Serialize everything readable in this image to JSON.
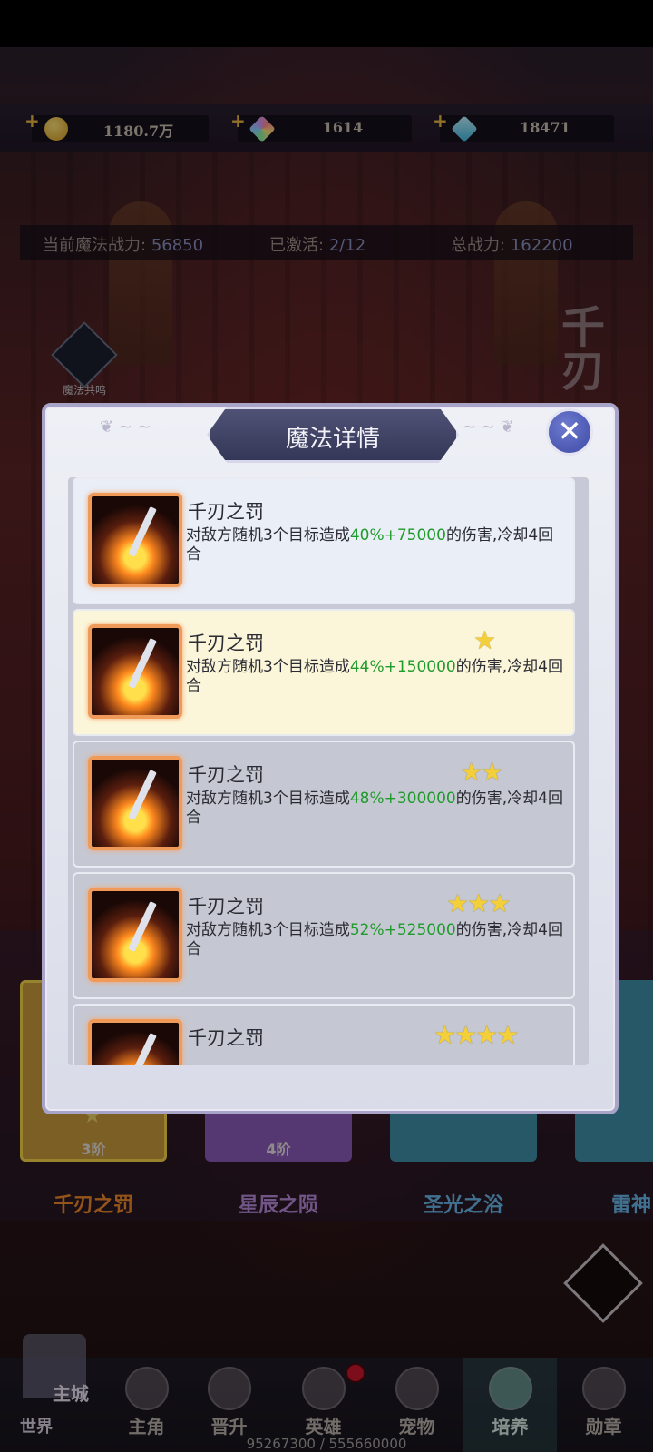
{
  "currency": [
    {
      "value": "1180.7万",
      "icon": "gold-coin-icon",
      "color": "#e8b23a"
    },
    {
      "value": "1614",
      "icon": "rainbow-gem-icon",
      "color": "#8bd1d8"
    },
    {
      "value": "18471",
      "icon": "blue-diamond-icon",
      "color": "#5ec9e8"
    }
  ],
  "stats": {
    "magic_power_label": "当前魔法战力:",
    "magic_power_value": "56850",
    "activated_label": "已激活:",
    "activated_value": "2/12",
    "total_power_label": "总战力:",
    "total_power_value": "162200"
  },
  "side": {
    "resonance_label": "魔法共鸣",
    "big_title_fragment": "千刃"
  },
  "modal": {
    "title": "魔法详情",
    "skills": [
      {
        "name": "千刃之罚",
        "stars": "",
        "desc_prefix": "对敌方随机3个目标造成",
        "highlight": "40%+75000",
        "desc_suffix": "的伤害,冷却4回合",
        "bg": "#e9eef7"
      },
      {
        "name": "千刃之罚",
        "stars": "★",
        "desc_prefix": "对敌方随机3个目标造成",
        "highlight": "44%+150000",
        "desc_suffix": "的伤害,冷却4回合",
        "bg": "#fbf6da"
      },
      {
        "name": "千刃之罚",
        "stars": "★★",
        "desc_prefix": "对敌方随机3个目标造成",
        "highlight": "48%+300000",
        "desc_suffix": "的伤害,冷却4回合",
        "bg": "#c5c8d2"
      },
      {
        "name": "千刃之罚",
        "stars": "★★★",
        "desc_prefix": "对敌方随机3个目标造成",
        "highlight": "52%+525000",
        "desc_suffix": "的伤害,冷却4回合",
        "bg": "#c5c8d2"
      },
      {
        "name": "千刃之罚",
        "stars": "★★★★",
        "desc_prefix": "",
        "highlight": "",
        "desc_suffix": "",
        "bg": "#c5c8d2"
      }
    ]
  },
  "cards": [
    {
      "level": "3阶",
      "name": "千刃之罚",
      "name_color": "#f08a2a",
      "bg": "#c79a3a",
      "star": "★"
    },
    {
      "level": "4阶",
      "name": "星辰之陨",
      "name_color": "#b58ad8",
      "bg": "#8a5ab8",
      "star": ""
    },
    {
      "level": "",
      "name": "圣光之浴",
      "name_color": "#6ab7e8",
      "bg": "#3f8ea8",
      "star": ""
    },
    {
      "level": "",
      "name": "雷神",
      "name_color": "#6ab7e8",
      "bg": "#3f8ea8",
      "star": ""
    }
  ],
  "nav": {
    "world": "世界",
    "main_city": "主城",
    "items": [
      "主角",
      "晋升",
      "英雄",
      "宠物",
      "培养",
      "勋章"
    ],
    "active_index": 4,
    "xp": "95267300 / 555660000"
  }
}
